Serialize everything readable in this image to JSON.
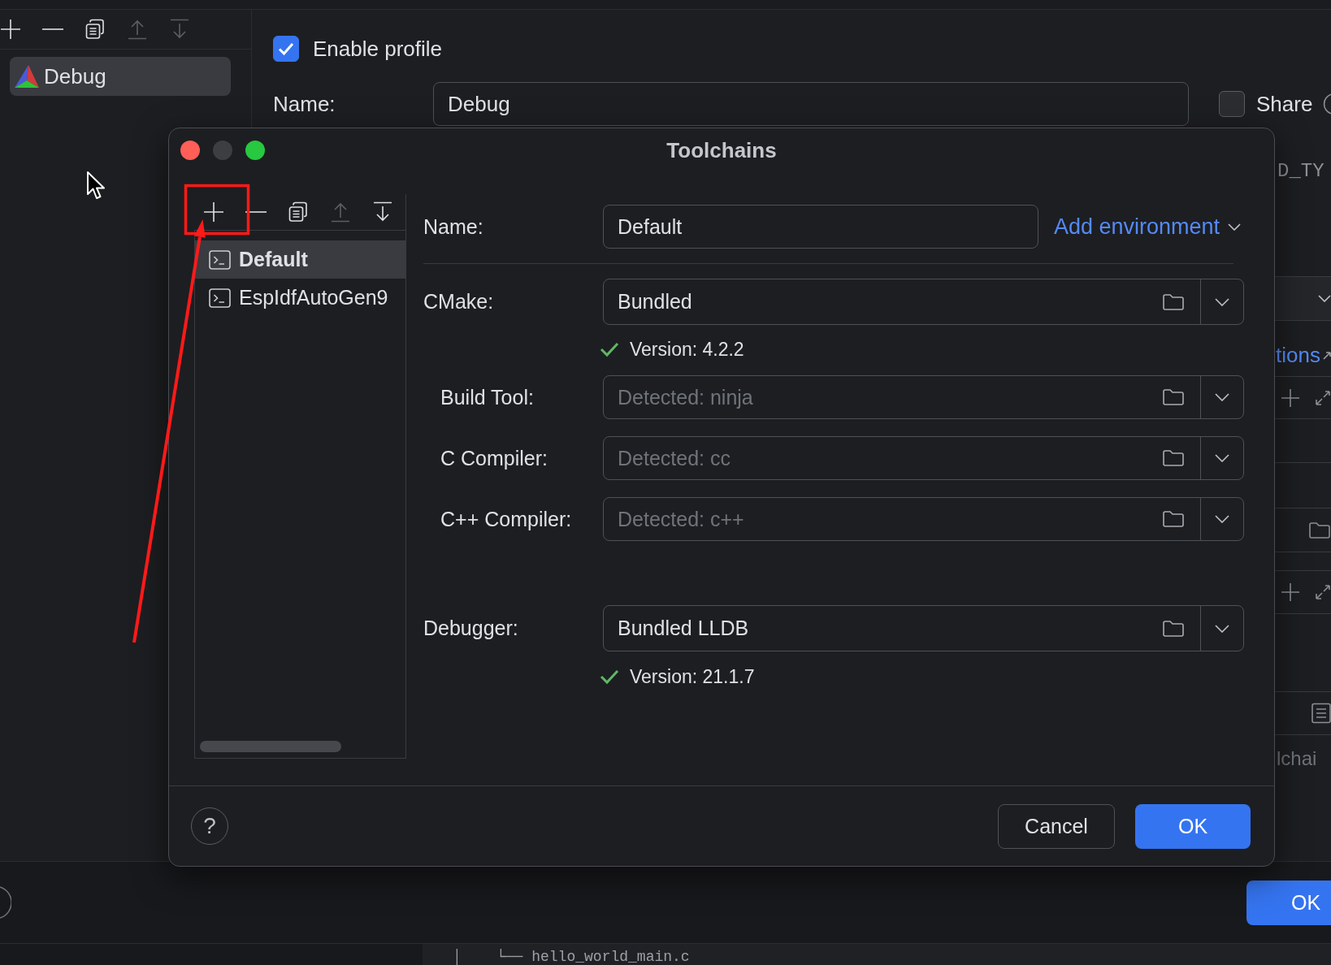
{
  "profiles_panel": {
    "toolbar": [
      {
        "kind": "add",
        "disabled": false
      },
      {
        "kind": "remove",
        "disabled": false
      },
      {
        "kind": "copy",
        "disabled": false
      },
      {
        "kind": "move_up",
        "disabled": true
      },
      {
        "kind": "move_down",
        "disabled": true
      }
    ],
    "profiles": [
      {
        "name": "Debug",
        "selected": true
      }
    ]
  },
  "profile": {
    "enable": {
      "label": "Enable profile",
      "checked": true
    },
    "name": {
      "label": "Name:",
      "value": "Debug"
    },
    "share": {
      "label": "Share",
      "checked": false
    }
  },
  "behind_dialog": {
    "text_1": "D_TY",
    "link": "tions",
    "text_2": "lchai"
  },
  "dialog": {
    "title": "Toolchains",
    "toolbar": [
      {
        "kind": "add",
        "disabled": false
      },
      {
        "kind": "remove",
        "disabled": false
      },
      {
        "kind": "copy",
        "disabled": false
      },
      {
        "kind": "move_up",
        "disabled": true
      },
      {
        "kind": "move_down",
        "disabled": false
      }
    ],
    "toolchains": [
      {
        "name": "Default",
        "selected": true,
        "is_default": true
      },
      {
        "name": "EspIdfAutoGen9",
        "selected": false,
        "is_default": false
      }
    ],
    "name": {
      "label": "Name:",
      "value": "Default"
    },
    "add_environment": "Add environment",
    "tools": [
      {
        "label": "CMake:",
        "value": "Bundled",
        "status": {
          "text": "Version: 4.2.2",
          "ok": true
        },
        "children": [
          {
            "label": "Build Tool:",
            "placeholder": "Detected: ninja"
          },
          {
            "label": "C Compiler:",
            "placeholder": "Detected: cc"
          },
          {
            "label": "C++ Compiler:",
            "placeholder": "Detected: c++"
          }
        ]
      },
      {
        "label": "Debugger:",
        "value": "Bundled LLDB",
        "status": {
          "text": "Version: 21.1.7",
          "ok": true
        }
      }
    ],
    "help": "?",
    "buttons": [
      {
        "label": "Cancel",
        "kind": "secondary"
      },
      {
        "label": "OK",
        "kind": "primary"
      }
    ]
  },
  "bottom": {
    "ok_button": "OK",
    "file_tree_line": "│    └── hello_world_main.c"
  }
}
